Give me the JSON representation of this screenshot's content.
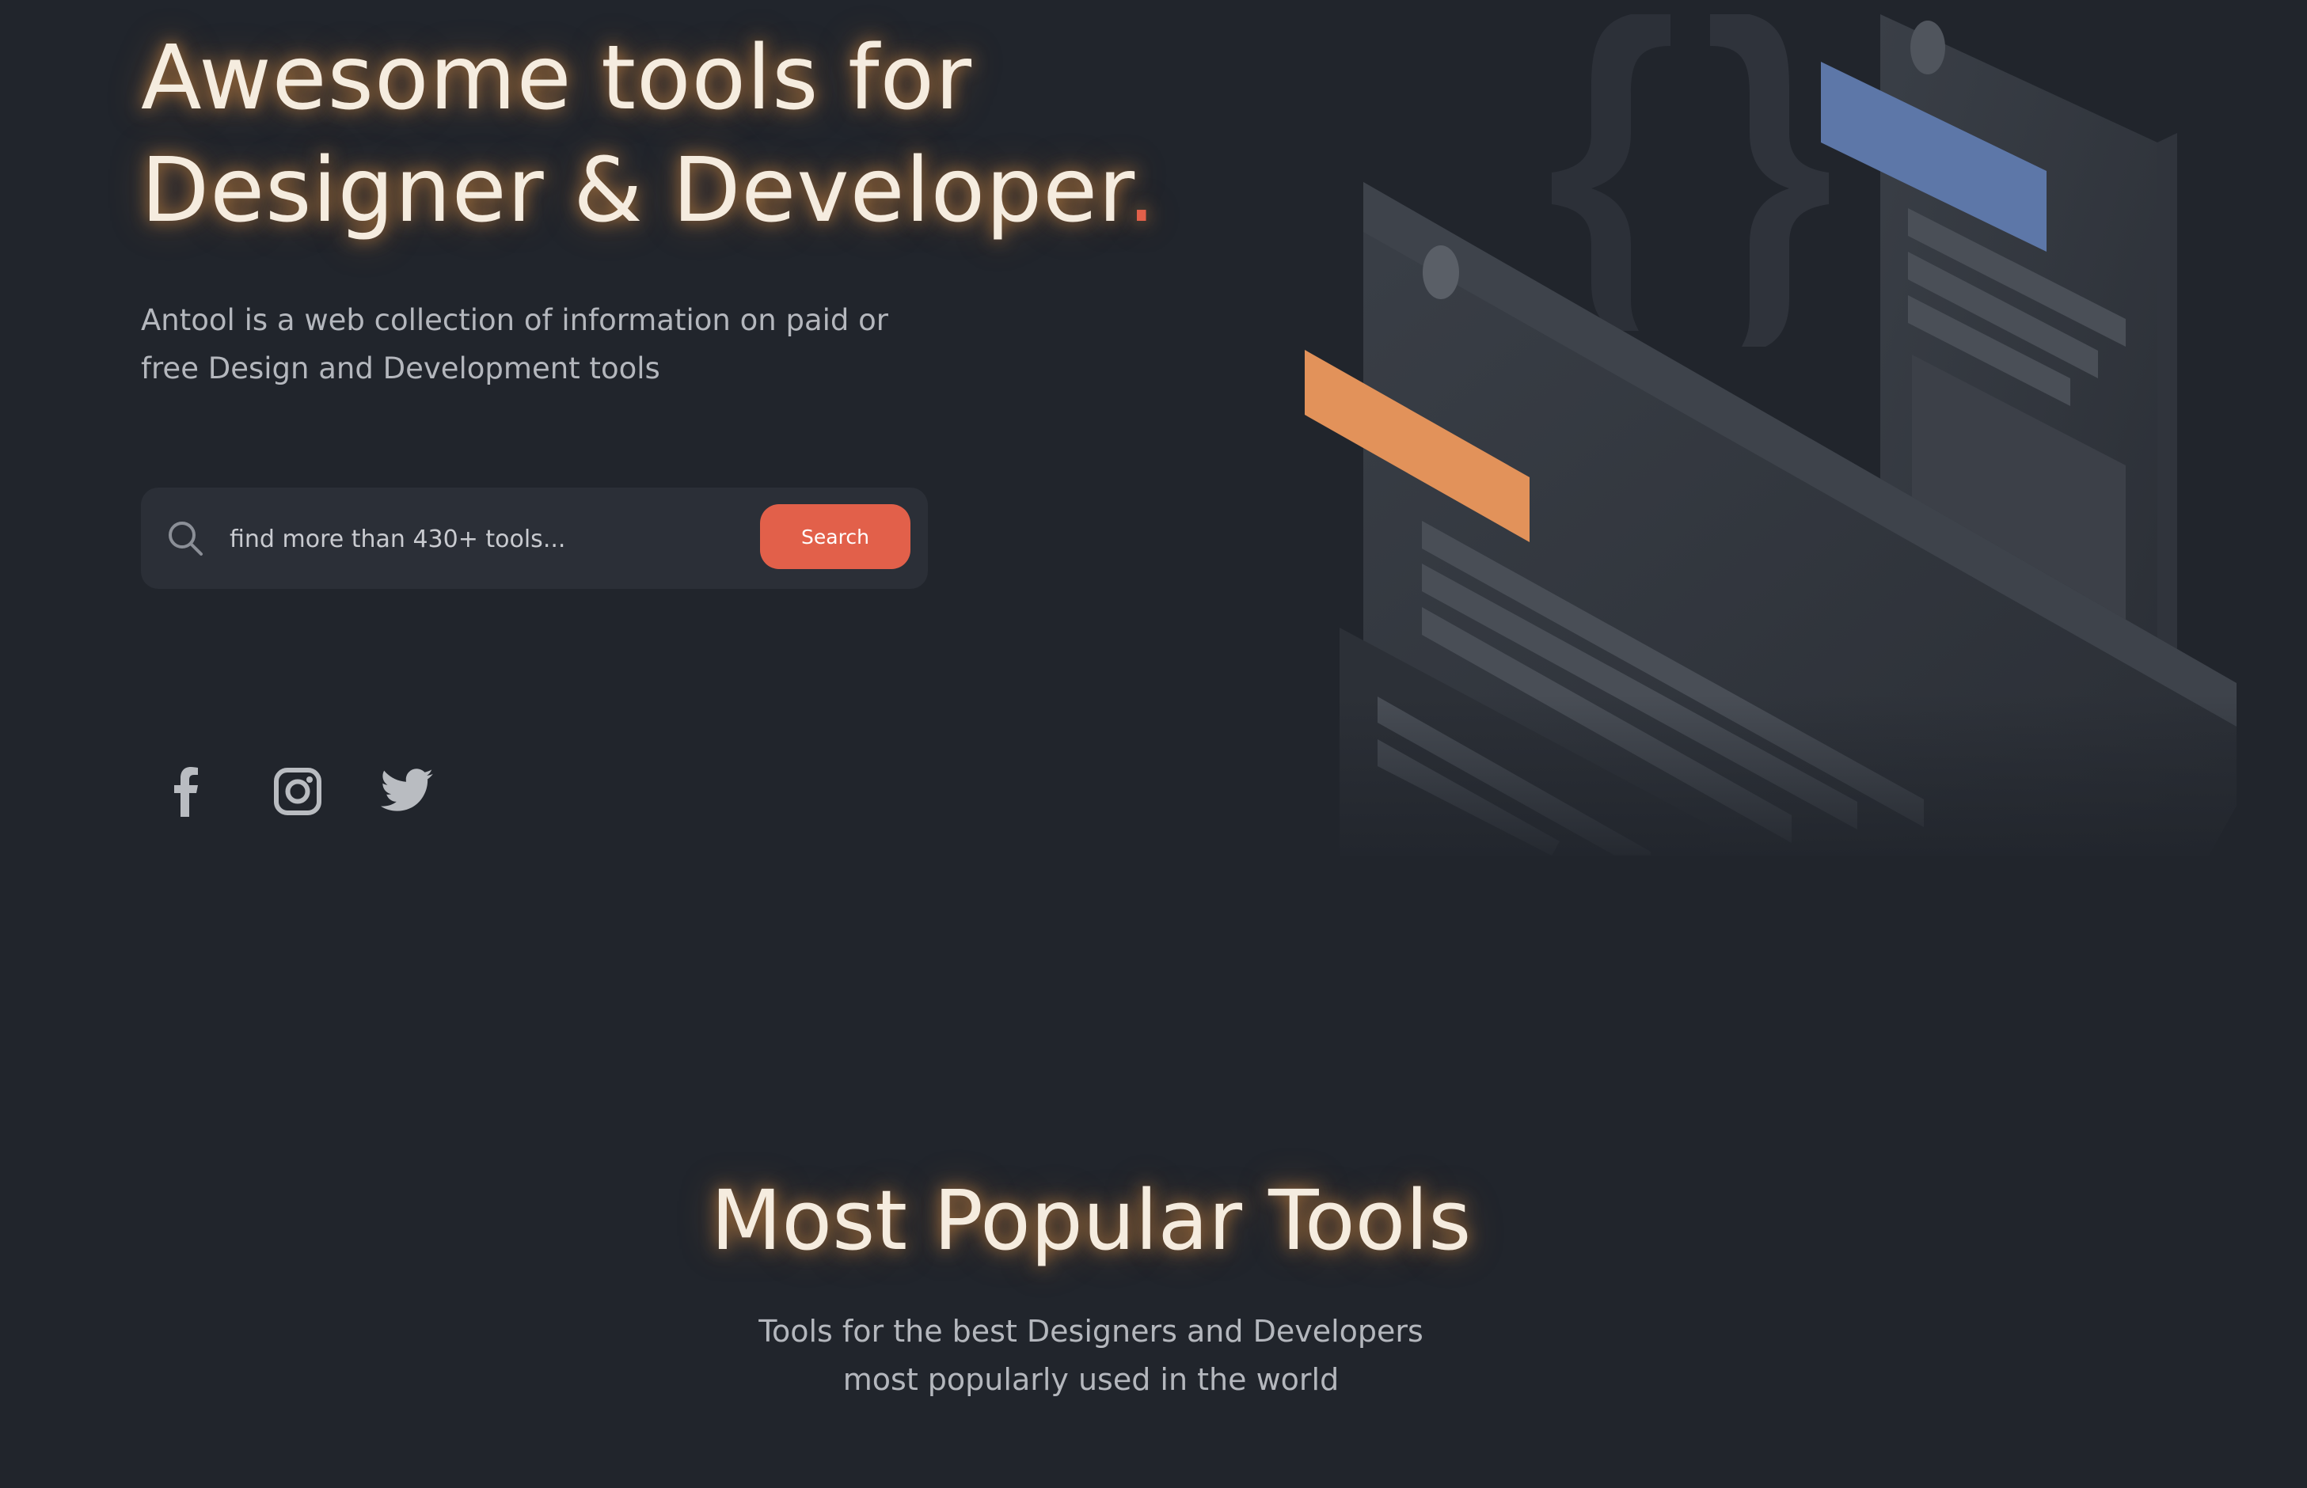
{
  "hero": {
    "title_line1": "Awesome tools for",
    "title_line2": "Designer & Developer",
    "title_dot": ".",
    "description": "Antool is a web collection of information on paid or free Design and Development tools"
  },
  "search": {
    "placeholder": "find more than 430+ tools...",
    "button_label": "Search",
    "icon": "search-icon"
  },
  "social_links": [
    {
      "icon": "facebook-icon"
    },
    {
      "icon": "instagram-icon"
    },
    {
      "icon": "twitter-icon"
    }
  ],
  "popular_section": {
    "title": "Most Popular Tools",
    "subtitle_line1": "Tools for the best Designers and Developers",
    "subtitle_line2": "most popularly used in the world"
  },
  "colors": {
    "background": "#21252c",
    "accent": "#e2604a",
    "title_text": "#f5ecdf",
    "body_text": "#b4b7bd",
    "search_background": "#2b2f37",
    "illustration_orange": "#e2925a",
    "illustration_blue": "#5d77a8"
  }
}
